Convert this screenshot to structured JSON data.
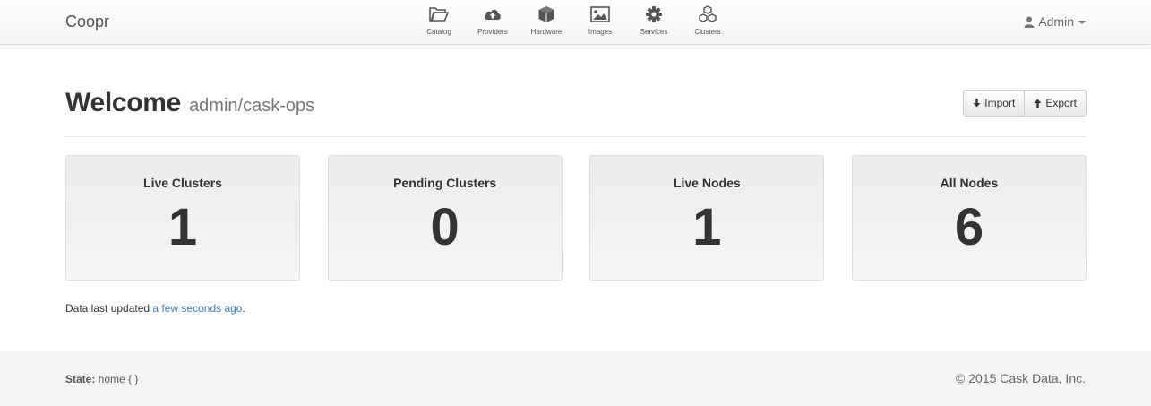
{
  "brand": "Coopr",
  "nav": [
    {
      "label": "Catalog",
      "icon": "folder-open-icon"
    },
    {
      "label": "Providers",
      "icon": "cloud-upload-icon"
    },
    {
      "label": "Hardware",
      "icon": "cube-icon"
    },
    {
      "label": "Images",
      "icon": "picture-icon"
    },
    {
      "label": "Services",
      "icon": "cog-icon"
    },
    {
      "label": "Clusters",
      "icon": "cubes-icon"
    }
  ],
  "user": {
    "name": "Admin",
    "icon": "user-icon"
  },
  "header": {
    "title": "Welcome",
    "subtitle": "admin/cask-ops"
  },
  "actions": {
    "import_label": "Import",
    "export_label": "Export"
  },
  "stats": [
    {
      "label": "Live Clusters",
      "value": "1"
    },
    {
      "label": "Pending Clusters",
      "value": "0"
    },
    {
      "label": "Live Nodes",
      "value": "1"
    },
    {
      "label": "All Nodes",
      "value": "6"
    }
  ],
  "updated": {
    "prefix": "Data last updated ",
    "link": "a few seconds ago",
    "suffix": "."
  },
  "footer": {
    "state_label": "State:",
    "state_value": " home { }",
    "copyright": "© 2015 Cask Data, Inc."
  },
  "colors": {
    "link": "#3a7bc0",
    "footer_bg": "#f5f5f5",
    "card_bg": "#efefef"
  }
}
